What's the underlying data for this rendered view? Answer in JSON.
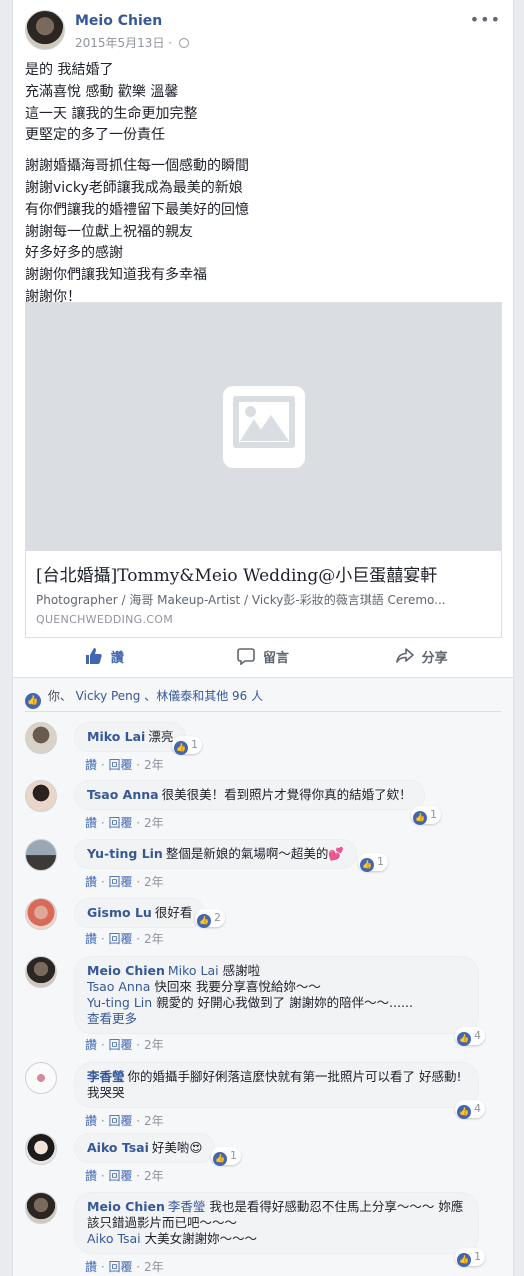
{
  "post": {
    "author": "Meio Chien",
    "timestamp": "2015年5月13日 ·",
    "more_label": "•••",
    "paragraphs": [
      "是的 我結婚了\n充滿喜悅 感動 歡樂 溫馨\n這一天 讓我的生命更加完整\n更堅定的多了一份責任",
      "謝謝婚攝海哥抓住每一個感動的瞬間\n謝謝vicky老師讓我成為最美的新娘\n有你們讓我的婚禮留下最美好的回憶\n謝謝每一位獻上祝福的親友\n好多好多的感謝\n謝謝你們讓我知道我有多幸福\n謝謝你！"
    ]
  },
  "link": {
    "title": "[台北婚攝]Tommy&Meio Wedding@小巨蛋囍宴軒",
    "description": "Photographer / 海哥 Makeup-Artist / Vicky彭-彩妝的薇言琪語 Ceremo...",
    "domain": "QUENCHWEDDING.COM"
  },
  "actions": {
    "like": "讚",
    "comment": "留言",
    "share": "分享"
  },
  "likes": {
    "prefix": "你、",
    "names": "Vicky Peng",
    "suffix": "、林儀泰和其他 96 人"
  },
  "colors": {
    "link": "#365899",
    "accent": "#4267b2",
    "muted": "#90949c"
  },
  "comments": [
    {
      "name": "Miko Lai",
      "text": "漂亮",
      "reactions": "1",
      "like": "讚",
      "reply": "回覆",
      "age": "2年"
    },
    {
      "name": "Tsao Anna",
      "text": "很美很美！看到照片才覺得你真的結婚了欸！",
      "reactions": "1",
      "like": "讚",
      "reply": "回覆",
      "age": "2年"
    },
    {
      "name": "Yu-ting Lin",
      "text": "整個是新娘的氣場啊～超美的💕",
      "reactions": "1",
      "like": "讚",
      "reply": "回覆",
      "age": "2年"
    },
    {
      "name": "Gismo Lu",
      "text": "很好看",
      "reactions": "2",
      "like": "讚",
      "reply": "回覆",
      "age": "2年"
    },
    {
      "name": "Meio Chien",
      "tag1": "Miko Lai",
      "text1": " 感謝啦",
      "tag2": "Tsao Anna",
      "text2": " 快回來 我要分享喜悅給妳～～",
      "tag3": "Yu-ting Lin",
      "text3": " 親愛的 好開心我做到了 謝謝妳的陪伴～～......",
      "see_more": "查看更多",
      "reactions": "4",
      "like": "讚",
      "reply": "回覆",
      "age": "2年"
    },
    {
      "name": "李香瑩",
      "text": "你的婚攝手腳好俐落這麼快就有第一批照片可以看了 好感動! 我哭哭",
      "reactions": "4",
      "like": "讚",
      "reply": "回覆",
      "age": "2年"
    },
    {
      "name": "Aiko Tsai",
      "text": "好美喲😍",
      "reactions": "1",
      "like": "讚",
      "reply": "回覆",
      "age": "2年"
    },
    {
      "name": "Meio Chien",
      "tag1": "李香瑩",
      "text1": " 我也是看得好感動忍不住馬上分享～～～ 妳應該只錯過影片而已吧～～～",
      "tag2": "Aiko Tsai",
      "text2": " 大美女謝謝妳～～～",
      "reactions": "1",
      "like": "讚",
      "reply": "回覆",
      "age": "2年"
    }
  ]
}
